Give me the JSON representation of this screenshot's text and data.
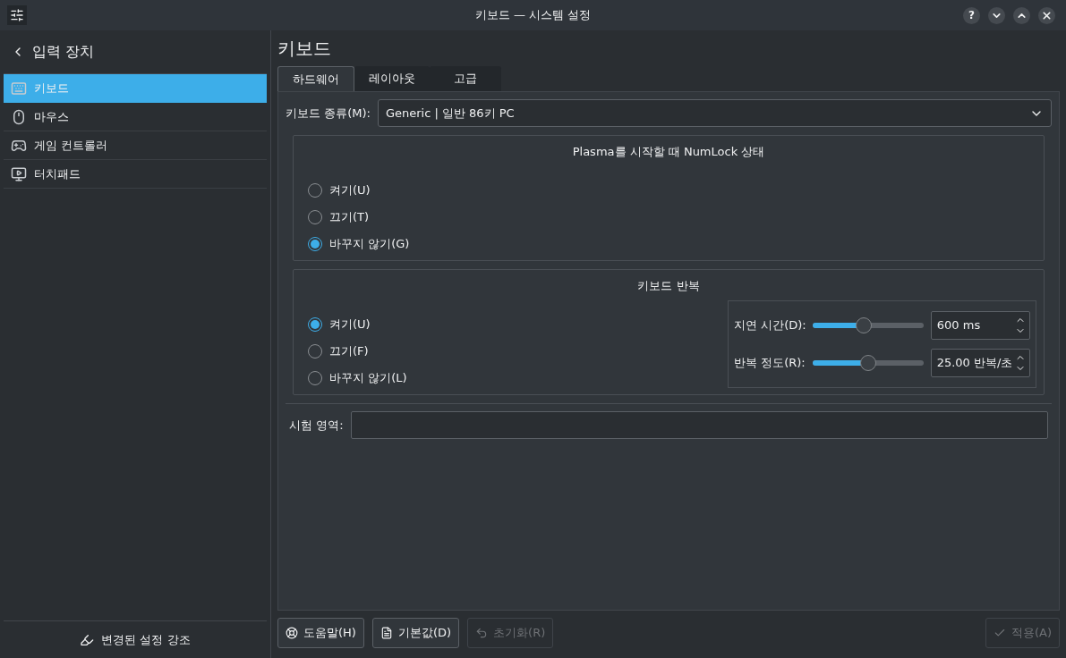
{
  "window": {
    "title": "키보드 — 시스템 설정",
    "help": "?"
  },
  "sidebar": {
    "back": "입력 장치",
    "items": [
      {
        "label": "키보드",
        "selected": true
      },
      {
        "label": "마우스",
        "selected": false
      },
      {
        "label": "게임 컨트롤러",
        "selected": false
      },
      {
        "label": "터치패드",
        "selected": false
      }
    ],
    "highlight": "변경된 설정 강조"
  },
  "page": {
    "title": "키보드",
    "tabs": [
      {
        "label": "하드웨어",
        "selected": true
      },
      {
        "label": "레이아웃",
        "selected": false
      },
      {
        "label": "고급",
        "selected": false
      }
    ],
    "model": {
      "label": "키보드 종류(M):",
      "value": "Generic | 일반 86키 PC"
    },
    "numlock": {
      "title": "Plasma를 시작할 때 NumLock 상태",
      "options": [
        {
          "label": "켜기(U)",
          "selected": false
        },
        {
          "label": "끄기(T)",
          "selected": false
        },
        {
          "label": "바꾸지 않기(G)",
          "selected": true
        }
      ]
    },
    "repeat": {
      "title": "키보드 반복",
      "options": [
        {
          "label": "켜기(U)",
          "selected": true
        },
        {
          "label": "끄기(F)",
          "selected": false
        },
        {
          "label": "바꾸지 않기(L)",
          "selected": false
        }
      ],
      "sliders": [
        {
          "label": "지연 시간(D):",
          "level": 0.46,
          "value": "600 ms"
        },
        {
          "label": "반복 정도(R):",
          "level": 0.5,
          "value": "25.00 반복/초"
        }
      ]
    },
    "test": {
      "label": "시험 영역:"
    }
  },
  "buttons": [
    {
      "label": "도움말(H)",
      "disabled": false
    },
    {
      "label": "기본값(D)",
      "disabled": false
    },
    {
      "label": "초기화(R)",
      "disabled": true
    },
    {
      "label": "적용(A)",
      "disabled": true
    }
  ]
}
